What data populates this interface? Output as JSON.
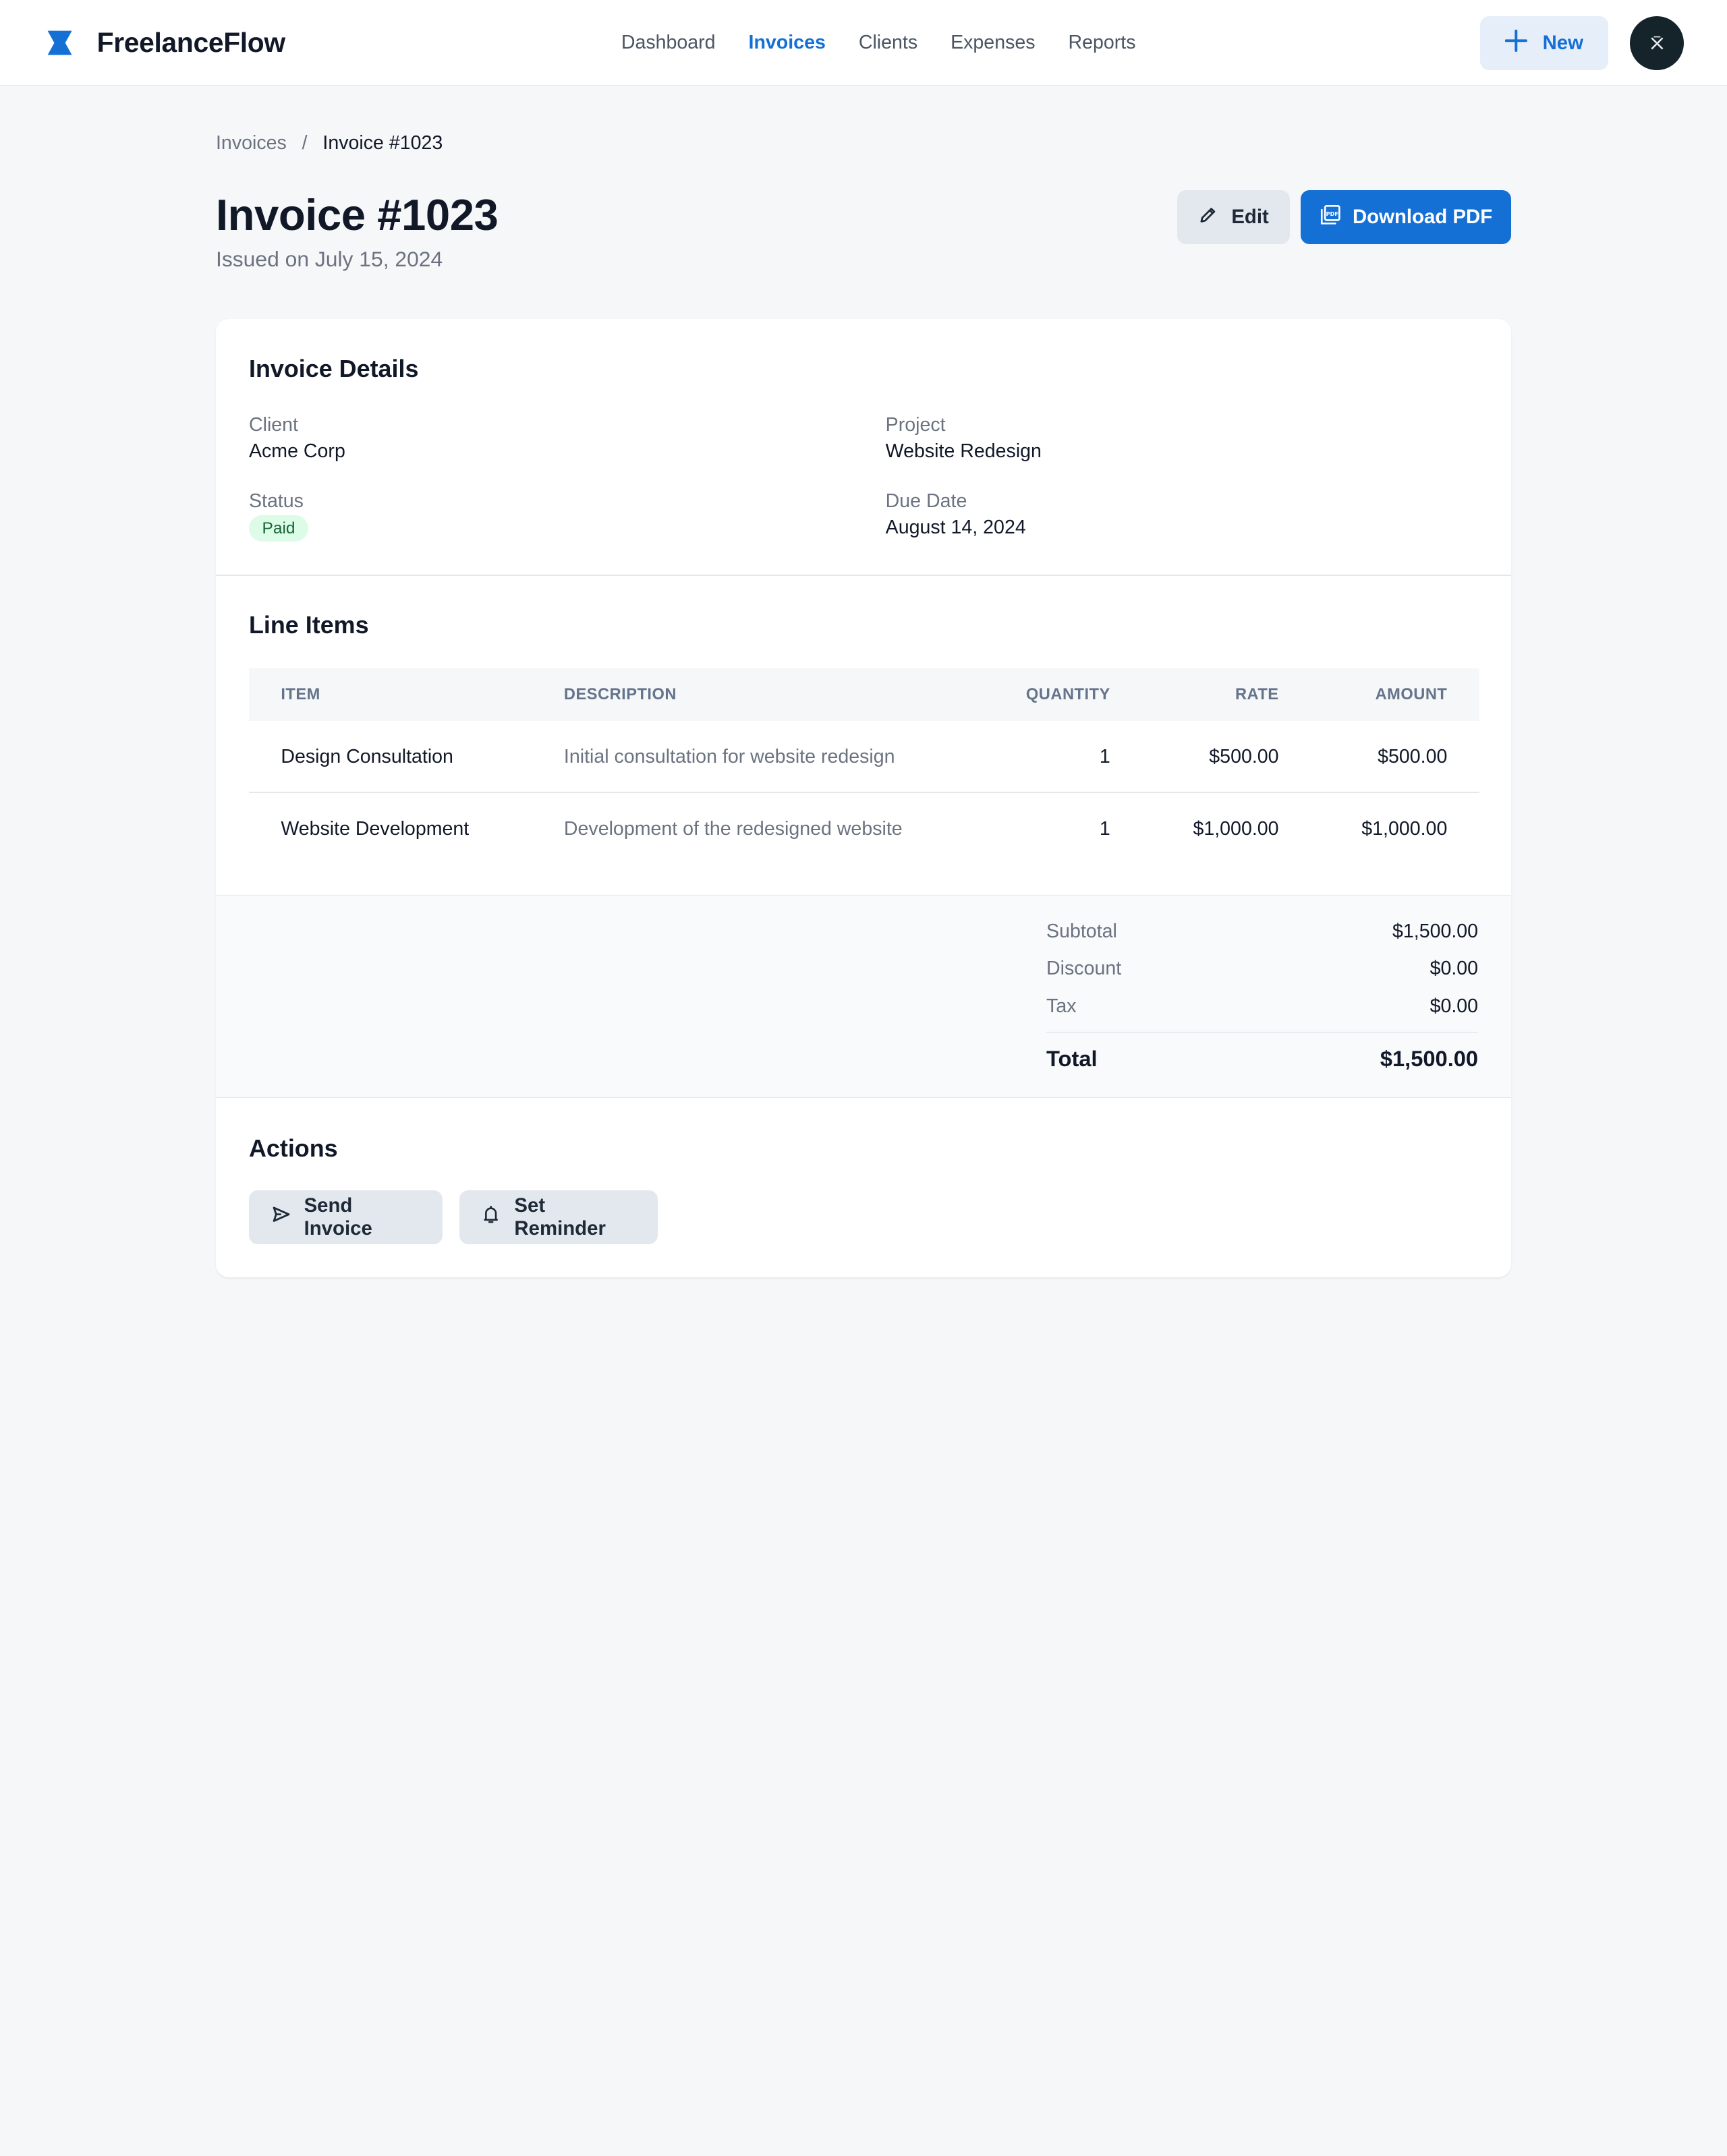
{
  "app": {
    "name": "FreelanceFlow",
    "brand_color": "#1570d6"
  },
  "nav": {
    "items": [
      {
        "label": "Dashboard",
        "active": false
      },
      {
        "label": "Invoices",
        "active": true
      },
      {
        "label": "Clients",
        "active": false
      },
      {
        "label": "Expenses",
        "active": false
      },
      {
        "label": "Reports",
        "active": false
      }
    ],
    "new_button": "New"
  },
  "breadcrumb": {
    "parent": "Invoices",
    "separator": "/",
    "current": "Invoice #1023"
  },
  "header": {
    "title": "Invoice #1023",
    "subtitle": "Issued on July 15, 2024",
    "edit_label": "Edit",
    "download_label": "Download PDF"
  },
  "details": {
    "title": "Invoice Details",
    "client_label": "Client",
    "client_value": "Acme Corp",
    "project_label": "Project",
    "project_value": "Website Redesign",
    "status_label": "Status",
    "status_value": "Paid",
    "due_label": "Due Date",
    "due_value": "August 14, 2024"
  },
  "line_items": {
    "title": "Line Items",
    "columns": [
      "ITEM",
      "DESCRIPTION",
      "QUANTITY",
      "RATE",
      "AMOUNT"
    ],
    "rows": [
      {
        "item": "Design Consultation",
        "description": "Initial consultation for website redesign",
        "quantity": "1",
        "rate": "$500.00",
        "amount": "$500.00"
      },
      {
        "item": "Website Development",
        "description": "Development of the redesigned website",
        "quantity": "1",
        "rate": "$1,000.00",
        "amount": "$1,000.00"
      }
    ]
  },
  "totals": {
    "subtotal_label": "Subtotal",
    "subtotal_value": "$1,500.00",
    "discount_label": "Discount",
    "discount_value": "$0.00",
    "tax_label": "Tax",
    "tax_value": "$0.00",
    "total_label": "Total",
    "total_value": "$1,500.00"
  },
  "actions": {
    "title": "Actions",
    "send_label": "Send Invoice",
    "reminder_label": "Set Reminder"
  },
  "icons": {
    "logo": "bowtie-logo-icon",
    "new": "plus-icon",
    "edit": "pencil-icon",
    "download": "pdf-icon",
    "send": "send-icon",
    "reminder": "bell-icon"
  }
}
